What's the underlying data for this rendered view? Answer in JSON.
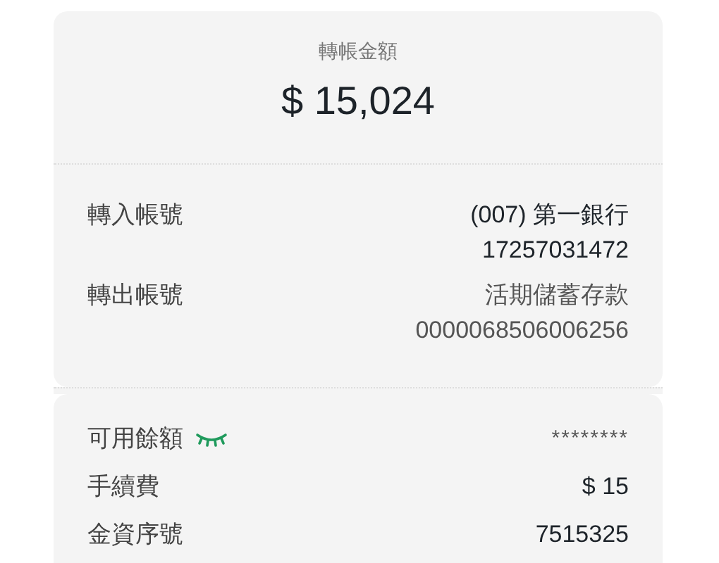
{
  "amount": {
    "label": "轉帳金額",
    "value": "$ 15,024"
  },
  "accounts": [
    {
      "label": "轉入帳號",
      "lines": [
        "(007) 第一銀行",
        "17257031472"
      ],
      "emphasis": true
    },
    {
      "label": "轉出帳號",
      "lines": [
        "活期儲蓄存款",
        "0000068506006256"
      ],
      "emphasis": false
    }
  ],
  "details": [
    {
      "label": "可用餘額",
      "value": "********",
      "kind": "hidden"
    },
    {
      "label": "手續費",
      "value": "$ 15",
      "kind": "plain"
    },
    {
      "label": "金資序號",
      "value": "7515325",
      "kind": "plain"
    }
  ]
}
